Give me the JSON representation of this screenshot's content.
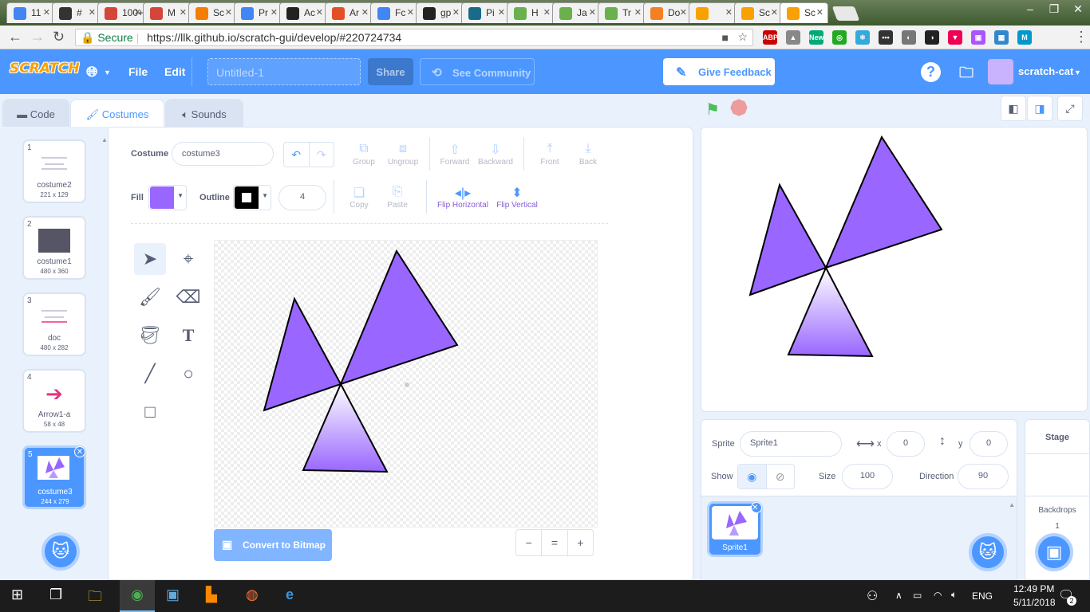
{
  "browser": {
    "tabs": [
      {
        "label": "11",
        "icon": "calendar-icon",
        "color": "#4285f4"
      },
      {
        "label": "#",
        "icon": "hash-icon",
        "color": "#333"
      },
      {
        "label": "100+",
        "icon": "gmail-icon",
        "color": "#d44638"
      },
      {
        "label": "M",
        "icon": "gmail-icon",
        "color": "#d44638"
      },
      {
        "label": "Sc",
        "icon": "blogger-icon",
        "color": "#f57d00"
      },
      {
        "label": "Pr",
        "icon": "docs-icon",
        "color": "#4285f4"
      },
      {
        "label": "Ac",
        "icon": "github-icon",
        "color": "#222"
      },
      {
        "label": "Ar",
        "icon": "html5-icon",
        "color": "#e34f26"
      },
      {
        "label": "Fc",
        "icon": "docs-icon",
        "color": "#4285f4"
      },
      {
        "label": "gp",
        "icon": "github-icon",
        "color": "#222"
      },
      {
        "label": "Pi",
        "icon": "bird-icon",
        "color": "#1a6a8a"
      },
      {
        "label": "H",
        "icon": "leaf-icon",
        "color": "#6ab04c"
      },
      {
        "label": "Ja",
        "icon": "leaf-icon",
        "color": "#6ab04c"
      },
      {
        "label": "Tr",
        "icon": "leaf-icon",
        "color": "#6ab04c"
      },
      {
        "label": "Do",
        "icon": "stackoverflow-icon",
        "color": "#f48024"
      },
      {
        "label": "",
        "icon": "scratch-cat-icon",
        "color": "#f8a100"
      },
      {
        "label": "Sc",
        "icon": "scratch-cat-icon",
        "color": "#f8a100"
      },
      {
        "label": "Sc",
        "icon": "scratch-cat-icon",
        "color": "#f8a100"
      }
    ],
    "secure_label": "Secure",
    "url": "https://llk.github.io/scratch-gui/develop/#220724734",
    "extensions": [
      {
        "label": "ABP",
        "color": "#c00"
      },
      {
        "label": "▲",
        "color": "#888"
      },
      {
        "label": "New",
        "color": "#0a7"
      },
      {
        "label": "◎",
        "color": "#2a2"
      },
      {
        "label": "⚛",
        "color": "#3ad"
      },
      {
        "label": "•••",
        "color": "#333"
      },
      {
        "label": "◐",
        "color": "#777"
      },
      {
        "label": "◑",
        "color": "#222"
      },
      {
        "label": "▼",
        "color": "#e05"
      },
      {
        "label": "▣",
        "color": "#a5f"
      },
      {
        "label": "▦",
        "color": "#38c"
      },
      {
        "label": "M",
        "color": "#09c"
      }
    ]
  },
  "menubar": {
    "logo": "SCRATCH",
    "file": "File",
    "edit": "Edit",
    "project_title_placeholder": "Untitled-1",
    "share": "Share",
    "see_community": "See Community",
    "give_feedback": "Give Feedback",
    "help": "?",
    "username": "scratch-cat"
  },
  "tabs": {
    "code": "Code",
    "costumes": "Costumes",
    "sounds": "Sounds"
  },
  "costumes": [
    {
      "num": "1",
      "name": "costume2",
      "size": "221 x 129"
    },
    {
      "num": "2",
      "name": "costume1",
      "size": "480 x 360"
    },
    {
      "num": "3",
      "name": "doc",
      "size": "480 x 282"
    },
    {
      "num": "4",
      "name": "Arrow1-a",
      "size": "58 x 48"
    },
    {
      "num": "5",
      "name": "costume3",
      "size": "244 x 279"
    }
  ],
  "paint": {
    "costume_label": "Costume",
    "costume_name": "costume3",
    "fill_label": "Fill",
    "fill_color": "#9966ff",
    "outline_label": "Outline",
    "outline_color": "#000000",
    "outline_width": "4",
    "group": "Group",
    "ungroup": "Ungroup",
    "forward": "Forward",
    "backward": "Backward",
    "front": "Front",
    "back": "Back",
    "copy": "Copy",
    "paste": "Paste",
    "flip_h": "Flip Horizontal",
    "flip_v": "Flip Vertical",
    "convert": "Convert to Bitmap",
    "zoom_out": "−",
    "zoom_reset": "=",
    "zoom_in": "+"
  },
  "sprite": {
    "sprite_label": "Sprite",
    "name": "Sprite1",
    "x_label": "x",
    "x": "0",
    "y_label": "y",
    "y": "0",
    "show_label": "Show",
    "size_label": "Size",
    "size": "100",
    "direction_label": "Direction",
    "direction": "90",
    "tile_name": "Sprite1"
  },
  "stage": {
    "label": "Stage",
    "backdrops_label": "Backdrops",
    "backdrops_count": "1"
  },
  "taskbar": {
    "lang": "ENG",
    "time": "12:49 PM",
    "date": "5/11/2018",
    "notif": "2"
  }
}
